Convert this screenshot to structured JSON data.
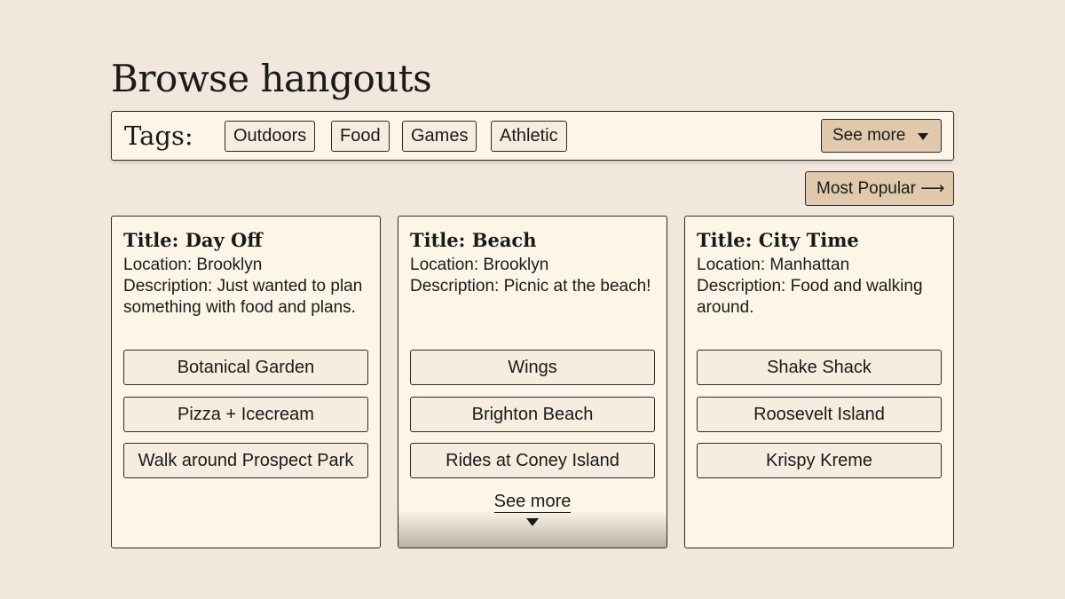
{
  "page": {
    "title": "Browse hangouts"
  },
  "tags": {
    "label": "Tags:",
    "items": [
      "Outdoors",
      "Food",
      "Games",
      "Athletic"
    ],
    "see_more_label": "See more",
    "see_more_icon": "caret-down-icon"
  },
  "sort": {
    "label": "Most Popular ⟶",
    "icon": "arrow-right-icon"
  },
  "hangouts": [
    {
      "title": "Title: Day Off",
      "location": "Location: Brooklyn",
      "description": "Description: Just wanted to plan something with food and plans.",
      "places": [
        "Botanical Garden",
        "Pizza + Icecream",
        "Walk around Prospect Park"
      ]
    },
    {
      "title": "Title: Beach",
      "location": "Location: Brooklyn",
      "description": "Description: Picnic at the beach!",
      "places": [
        "Wings",
        "Brighton Beach",
        "Rides at Coney Island"
      ],
      "see_more_label": "See more"
    },
    {
      "title": "Title: City Time",
      "location": "Location: Manhattan",
      "description": "Description: Food and walking around.",
      "places": [
        "Shake Shack",
        "Roosevelt Island",
        "Krispy Kreme"
      ]
    }
  ],
  "colors": {
    "background": "#f1e7dc",
    "card": "#fdf6e8",
    "accent_button": "#e1c9ad",
    "border": "#2a2a2a"
  }
}
